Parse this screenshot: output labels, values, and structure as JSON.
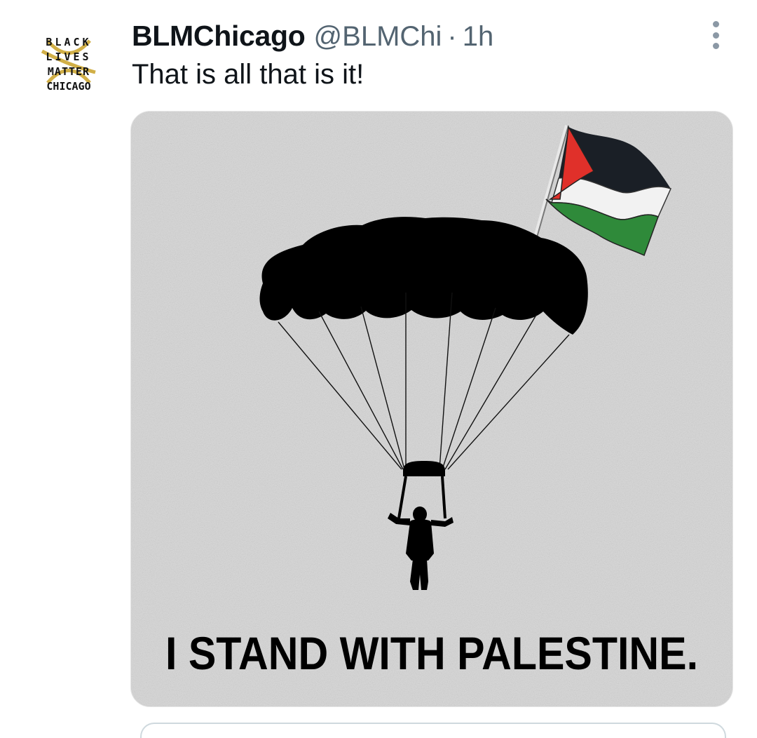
{
  "tweet": {
    "author_name": "BLMChicago",
    "author_handle": "@BLMChi",
    "separator": "·",
    "timestamp": "1h",
    "text": "That is all that is it!"
  },
  "avatar": {
    "logo_lines": [
      "BLACK",
      "LIVES",
      "MATTER",
      "CHICAGO"
    ],
    "colors": {
      "text": "#111111",
      "accent": "#c9a227"
    }
  },
  "media": {
    "caption": "I STAND WITH PALESTINE.",
    "icon": "parachute-with-palestine-flag",
    "colors": {
      "background": "#d9d9d9",
      "silhouette": "#000000",
      "flag_black": "#1a1f26",
      "flag_white": "#f2f2f2",
      "flag_green": "#2f8a3a",
      "flag_red": "#e0302a"
    }
  }
}
